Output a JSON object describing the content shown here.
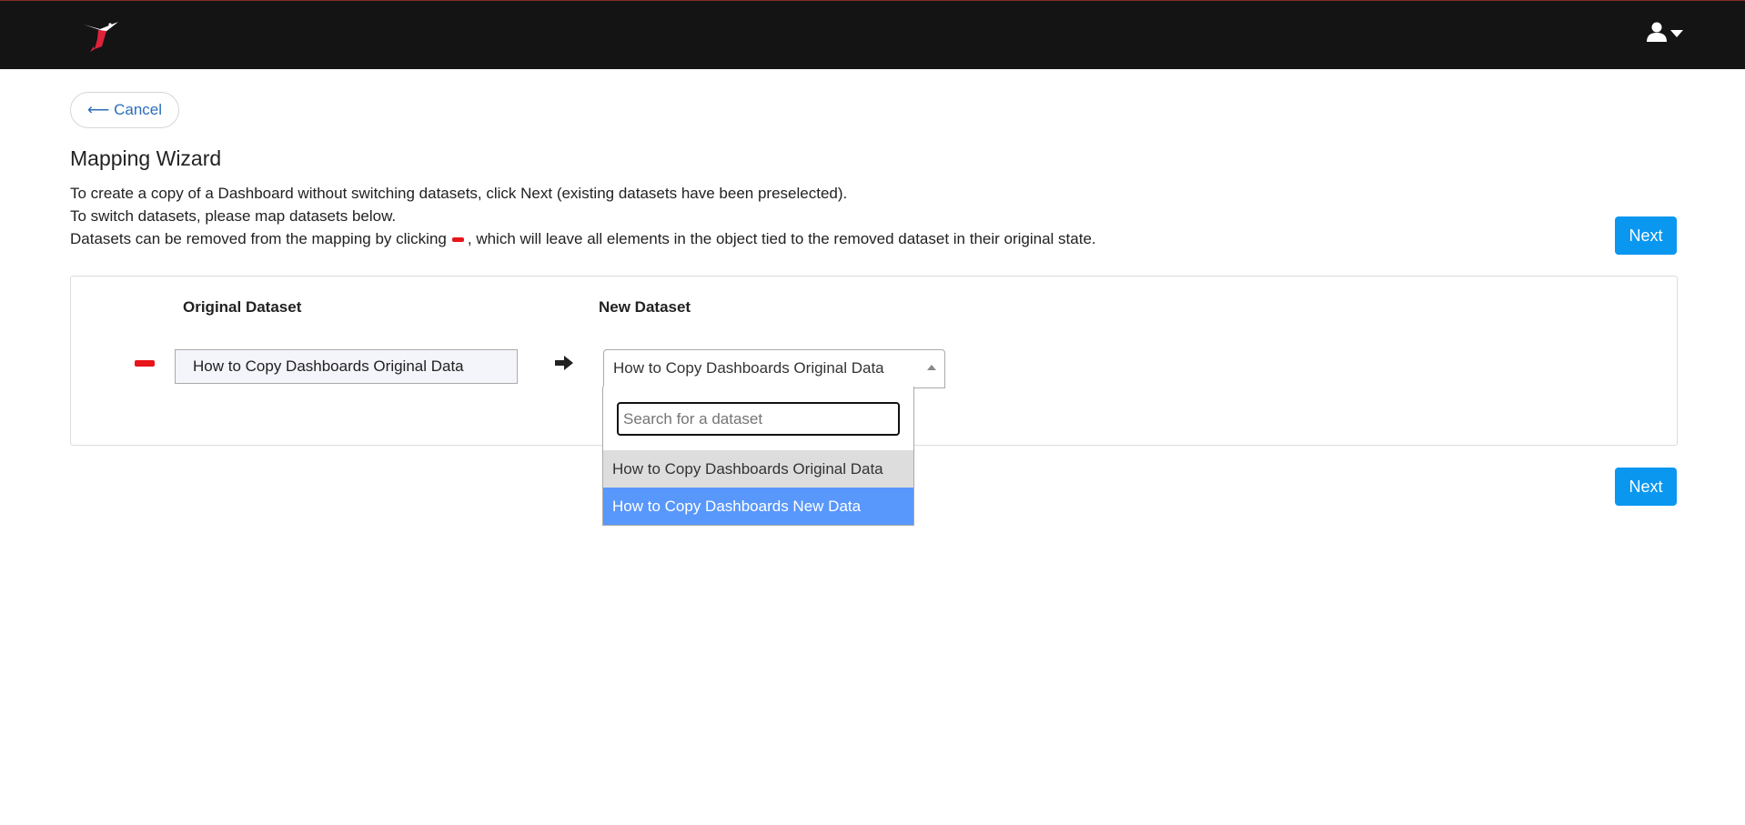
{
  "header": {
    "logo_icon": "hummingbird-logo-icon",
    "user_icon": "user-icon",
    "user_menu_caret": "caret-down-icon"
  },
  "cancel": {
    "label": "⟵ Cancel"
  },
  "title": "Mapping Wizard",
  "instructions": {
    "line1": "To create a copy of a Dashboard without switching datasets, click Next (existing datasets have been preselected).",
    "line2": "To switch datasets, please map datasets below.",
    "line3_before": "Datasets can be removed from the mapping by clicking",
    "line3_after": ", which will leave all elements in the object tied to the removed dataset in their original state."
  },
  "next_label": "Next",
  "mapping": {
    "original_header": "Original Dataset",
    "new_header": "New Dataset",
    "rows": [
      {
        "original": "How to Copy Dashboards Original Data",
        "selected_new": "How to Copy Dashboards Original Data"
      }
    ]
  },
  "dropdown": {
    "search_placeholder": "Search for a dataset",
    "search_value": "",
    "options": [
      "How to Copy Dashboards Original Data",
      "How to Copy Dashboards New Data"
    ]
  },
  "colors": {
    "topbar": "#141414",
    "next_button": "#0a97f0",
    "remove_red": "#e8151b",
    "option_highlight": "#5897fb",
    "option_selected": "#dddddd",
    "link_blue": "#2a6ebb"
  }
}
